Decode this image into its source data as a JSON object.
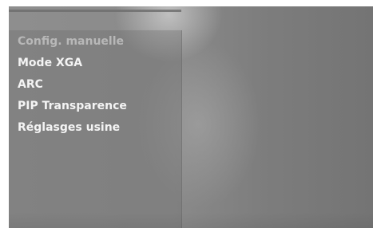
{
  "menu": {
    "items": [
      {
        "label": "Config. manuelle",
        "state": "disabled"
      },
      {
        "label": "Mode XGA",
        "state": "normal"
      },
      {
        "label": "ARC",
        "state": "normal"
      },
      {
        "label": "PIP Transparence",
        "state": "normal"
      },
      {
        "label": "Réglasges usine",
        "state": "normal"
      }
    ]
  },
  "colors": {
    "text": "#f4f4f4",
    "text_disabled": "#b8b8b8",
    "background": "#8a8a8a"
  }
}
